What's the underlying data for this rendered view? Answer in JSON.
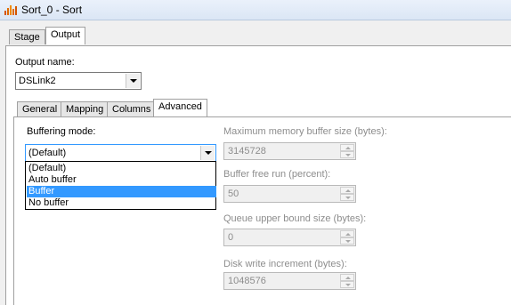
{
  "window": {
    "title": "Sort_0 - Sort",
    "icon": "bar-chart-icon"
  },
  "outer_tabs": [
    {
      "label": "Stage",
      "active": false
    },
    {
      "label": "Output",
      "active": true
    }
  ],
  "output_name": {
    "label": "Output name:",
    "value": "DSLink2"
  },
  "inner_tabs": [
    {
      "label": "General",
      "active": false
    },
    {
      "label": "Mapping",
      "active": false
    },
    {
      "label": "Columns",
      "active": false
    },
    {
      "label": "Advanced",
      "active": true
    }
  ],
  "buffering": {
    "label": "Buffering mode:",
    "value": "(Default)",
    "options": [
      "(Default)",
      "Auto buffer",
      "Buffer",
      "No buffer"
    ],
    "highlighted": "Buffer"
  },
  "fields": {
    "max_memory": {
      "label": "Maximum memory buffer size (bytes):",
      "value": "3145728"
    },
    "free_run": {
      "label": "Buffer free run (percent):",
      "value": "50"
    },
    "queue_upper": {
      "label": "Queue upper bound size (bytes):",
      "value": "0"
    },
    "disk_write": {
      "label": "Disk write increment (bytes):",
      "value": "1048576"
    }
  },
  "colors": {
    "selection": "#3399ff",
    "disabled_text": "#8d8d8d"
  }
}
